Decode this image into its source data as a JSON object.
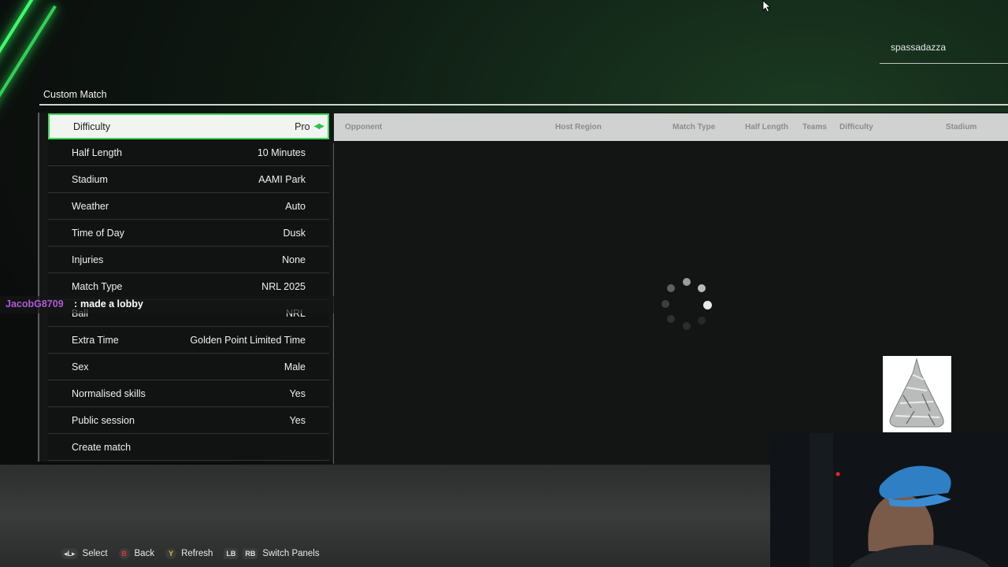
{
  "header": {
    "username": "spassadazza",
    "page_title": "Custom Match"
  },
  "options": [
    {
      "label": "Difficulty",
      "value": "Pro",
      "selected": true
    },
    {
      "label": "Half Length",
      "value": "10 Minutes"
    },
    {
      "label": "Stadium",
      "value": "AAMI Park"
    },
    {
      "label": "Weather",
      "value": "Auto"
    },
    {
      "label": "Time of Day",
      "value": "Dusk"
    },
    {
      "label": "Injuries",
      "value": "None"
    },
    {
      "label": "Match Type",
      "value": "NRL 2025"
    },
    {
      "label": "Ball",
      "value": "NRL"
    },
    {
      "label": "Extra Time",
      "value": "Golden Point Limited Time"
    },
    {
      "label": "Sex",
      "value": "Male"
    },
    {
      "label": "Normalised skills",
      "value": "Yes"
    },
    {
      "label": "Public session",
      "value": "Yes"
    },
    {
      "label": "Create match",
      "value": ""
    }
  ],
  "lobby_table": {
    "columns": [
      "Opponent",
      "Host Region",
      "Match Type",
      "Half Length",
      "Teams",
      "Difficulty",
      "Stadium"
    ],
    "status": "loading"
  },
  "chat": {
    "user": "JacobG8709",
    "separator": ":",
    "message": "made a lobby"
  },
  "controls": [
    {
      "glyph": "◂L▸",
      "label": "Select"
    },
    {
      "glyph": "B",
      "label": "Back"
    },
    {
      "glyph": "Y",
      "label": "Refresh"
    },
    {
      "glyph": "LB",
      "label": ""
    },
    {
      "glyph": "RB",
      "label": "Switch Panels"
    }
  ],
  "colors": {
    "accent": "#3cd85a",
    "chat_user": "#b05ad8"
  }
}
